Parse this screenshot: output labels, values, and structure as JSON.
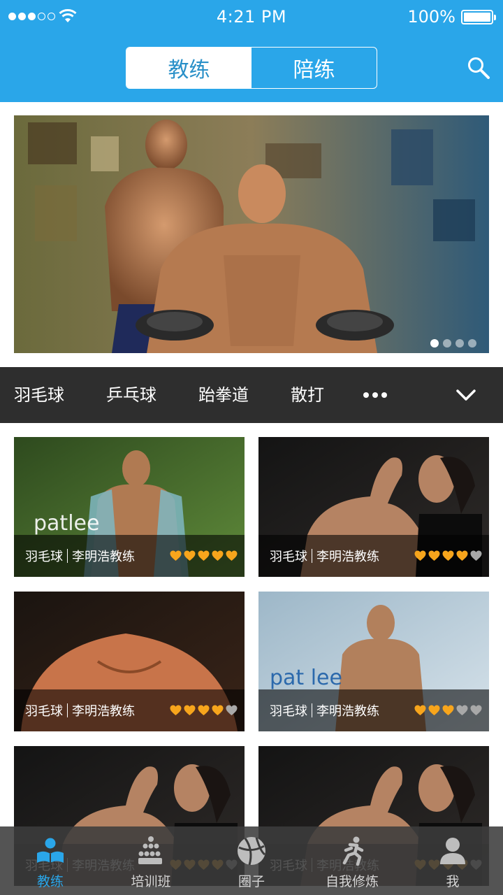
{
  "status_bar": {
    "time": "4:21 PM",
    "battery": "100%",
    "signal_bars_filled": 3,
    "signal_bars_total": 5
  },
  "nav": {
    "tabs": [
      {
        "label": "教练",
        "active": true
      },
      {
        "label": "陪练",
        "active": false
      }
    ],
    "search_icon": "search-icon"
  },
  "banner": {
    "current_index": 0,
    "slide_count": 4
  },
  "categories": {
    "items": [
      "羽毛球",
      "乒乓球",
      "跆拳道",
      "散打"
    ],
    "more_icon": "more-icon",
    "expand_icon": "chevron-down-icon"
  },
  "cards": [
    {
      "sport": "羽毛球",
      "coach": "李明浩教练",
      "rating": 5,
      "max_rating": 5,
      "image_watermark": "patlee"
    },
    {
      "sport": "羽毛球",
      "coach": "李明浩教练",
      "rating": 4,
      "max_rating": 5
    },
    {
      "sport": "羽毛球",
      "coach": "李明浩教练",
      "rating": 4,
      "max_rating": 5
    },
    {
      "sport": "羽毛球",
      "coach": "李明浩教练",
      "rating": 3,
      "max_rating": 5,
      "image_watermark": "pat lee"
    },
    {
      "sport": "羽毛球",
      "coach": "李明浩教练",
      "rating": 4,
      "max_rating": 5
    },
    {
      "sport": "羽毛球",
      "coach": "李明浩教练",
      "rating": 4,
      "max_rating": 5
    }
  ],
  "tabbar": {
    "items": [
      {
        "label": "教练",
        "icon": "coach-icon",
        "active": true
      },
      {
        "label": "培训班",
        "icon": "class-icon",
        "active": false
      },
      {
        "label": "圈子",
        "icon": "ball-icon",
        "active": false
      },
      {
        "label": "自我修炼",
        "icon": "running-icon",
        "active": false
      },
      {
        "label": "我",
        "icon": "user-icon",
        "active": false
      }
    ]
  },
  "colors": {
    "brand": "#2aa6e9",
    "heart_on": "#f7a51c",
    "heart_off": "#a8a8a8",
    "category_bar": "#2e2e2e"
  }
}
